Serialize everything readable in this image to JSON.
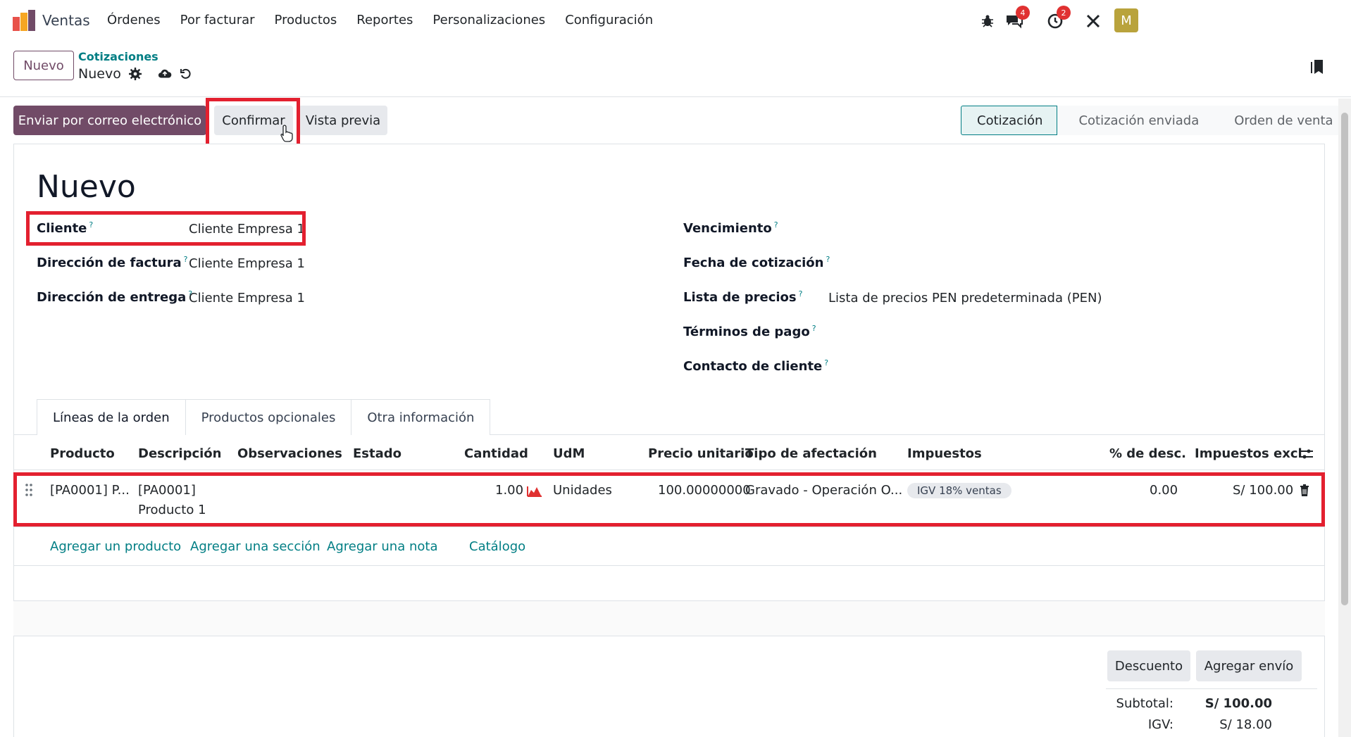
{
  "navbar": {
    "app_name": "Ventas",
    "menu": [
      "Órdenes",
      "Por facturar",
      "Productos",
      "Reportes",
      "Personalizaciones",
      "Configuración"
    ],
    "messages_badge": "4",
    "activities_badge": "2",
    "avatar_letter": "M",
    "avatar_color": "#b9a33c"
  },
  "control": {
    "new_label": "Nuevo",
    "breadcrumb_parent": "Cotizaciones",
    "breadcrumb_current": "Nuevo"
  },
  "actions": {
    "send_email": "Enviar por correo electrónico",
    "confirm": "Confirmar",
    "preview": "Vista previa"
  },
  "status": [
    "Cotización",
    "Cotización enviada",
    "Orden de venta"
  ],
  "form": {
    "title": "Nuevo",
    "left_fields": [
      {
        "label": "Cliente",
        "value": "Cliente Empresa 1"
      },
      {
        "label": "Dirección de factura",
        "value": "Cliente Empresa 1"
      },
      {
        "label": "Dirección de entrega",
        "value": "Cliente Empresa 1"
      }
    ],
    "right_fields": [
      {
        "label": "Vencimiento",
        "value": ""
      },
      {
        "label": "Fecha de cotización",
        "value": ""
      },
      {
        "label": "Lista de precios",
        "value": "Lista de precios PEN predeterminada (PEN)"
      },
      {
        "label": "Términos de pago",
        "value": ""
      },
      {
        "label": "Contacto de cliente",
        "value": ""
      }
    ],
    "help_mark": "?"
  },
  "tabs": [
    "Líneas de la orden",
    "Productos opcionales",
    "Otra información"
  ],
  "table": {
    "headers": [
      "Producto",
      "Descripción",
      "Observaciones",
      "Estado",
      "Cantidad",
      "UdM",
      "Precio unitario",
      "Tipo de afectación",
      "Impuestos",
      "% de desc.",
      "Impuestos excl."
    ],
    "row": {
      "product": "[PA0001] P...",
      "description_1": "[PA0001]",
      "description_2": "Producto 1",
      "quantity": "1.00",
      "uom": "Unidades",
      "unit_price": "100.00000000",
      "affectation": "Gravado - Operación O...",
      "tax": "IGV 18% ventas",
      "discount": "0.00",
      "subtotal": "S/ 100.00"
    },
    "add_links": [
      "Agregar un producto",
      "Agregar una sección",
      "Agregar una nota",
      "Catálogo"
    ]
  },
  "footer_buttons": {
    "discount": "Descuento",
    "shipping": "Agregar envío"
  },
  "totals": {
    "subtotal_label": "Subtotal:",
    "subtotal_value": "S/ 100.00",
    "igv_label": "IGV:",
    "igv_value": "S/ 18.00"
  },
  "colors": {
    "brand": "#714b67",
    "link": "#017e84",
    "highlight": "#e3202f"
  }
}
